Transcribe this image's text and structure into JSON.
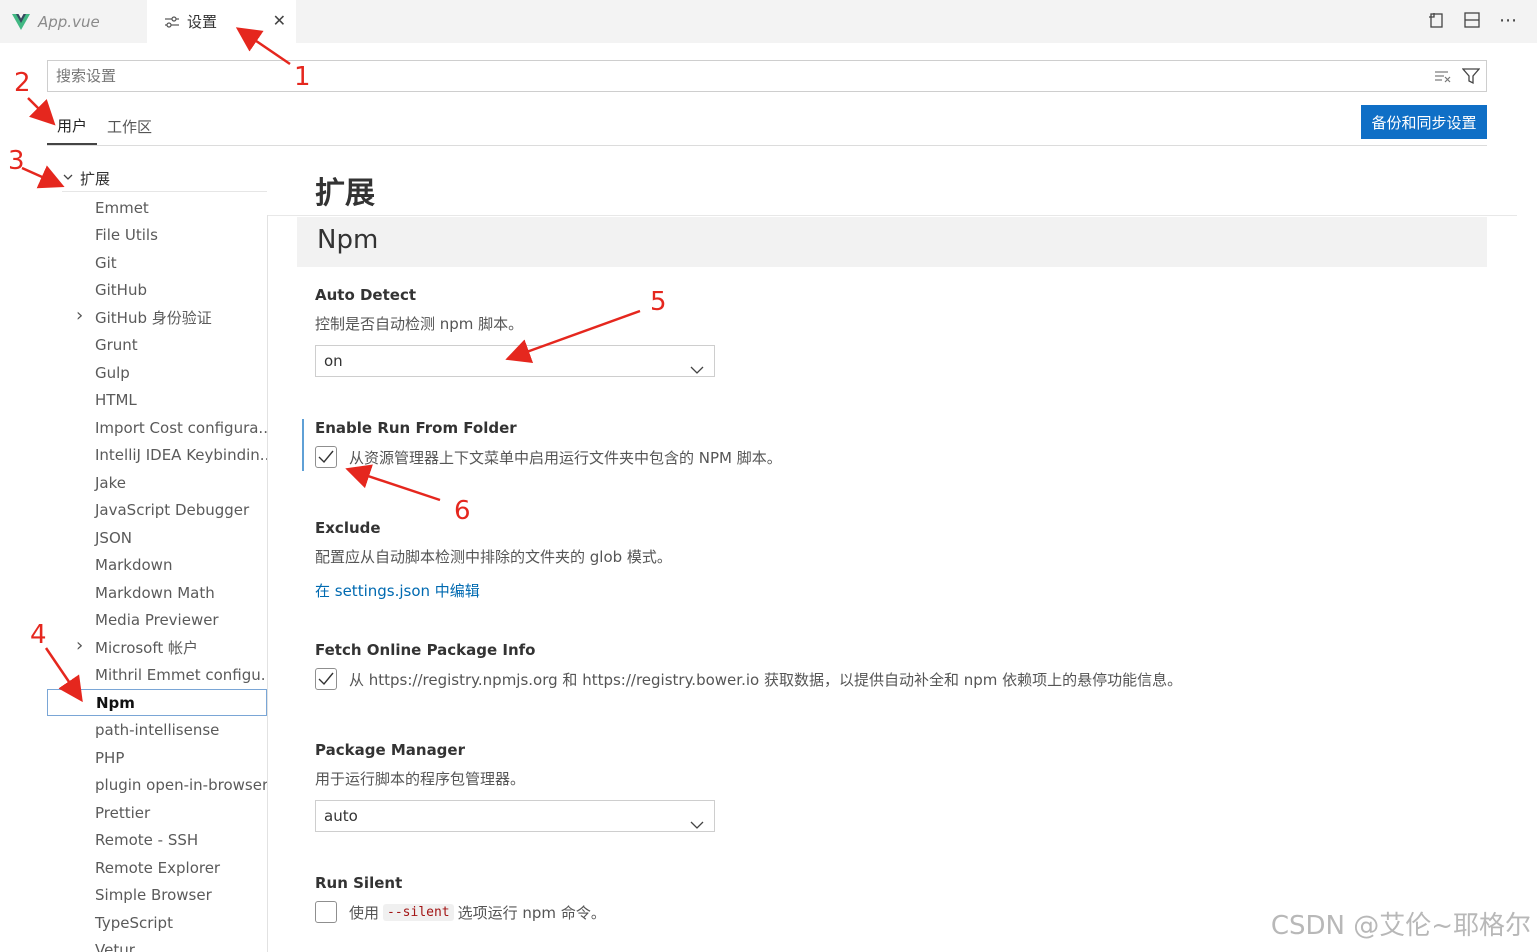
{
  "tabs": {
    "app_tab": "App.vue",
    "settings_tab": "设置"
  },
  "search": {
    "placeholder": "搜索设置"
  },
  "scope": {
    "user": "用户",
    "workspace": "工作区",
    "sync_button": "备份和同步设置"
  },
  "toc": {
    "group": "扩展",
    "items": [
      "Emmet",
      "File Utils",
      "Git",
      "GitHub",
      "GitHub 身份验证",
      "Grunt",
      "Gulp",
      "HTML",
      "Import Cost configura...",
      "IntelliJ IDEA Keybindin...",
      "Jake",
      "JavaScript Debugger",
      "JSON",
      "Markdown",
      "Markdown Math",
      "Media Previewer",
      "Microsoft 帐户",
      "Mithril Emmet configu...",
      "Npm",
      "path-intellisense",
      "PHP",
      "plugin open-in-browser",
      "Prettier",
      "Remote - SSH",
      "Remote Explorer",
      "Simple Browser",
      "TypeScript",
      "Vetur"
    ],
    "selected": "Npm"
  },
  "main": {
    "section_title": "扩展",
    "subsection_title": "Npm",
    "settings": {
      "auto_detect": {
        "title": "Auto Detect",
        "desc": "控制是否自动检测 npm 脚本。",
        "value": "on"
      },
      "run_from_folder": {
        "title": "Enable Run From Folder",
        "desc": "从资源管理器上下文菜单中启用运行文件夹中包含的 NPM 脚本。",
        "checked": true
      },
      "exclude": {
        "title": "Exclude",
        "desc": "配置应从自动脚本检测中排除的文件夹的 glob 模式。",
        "link": "在 settings.json 中编辑"
      },
      "fetch_online": {
        "title": "Fetch Online Package Info",
        "desc": "从 https://registry.npmjs.org 和 https://registry.bower.io 获取数据，以提供自动补全和 npm 依赖项上的悬停功能信息。",
        "checked": true
      },
      "package_manager": {
        "title": "Package Manager",
        "desc": "用于运行脚本的程序包管理器。",
        "value": "auto"
      },
      "run_silent": {
        "title": "Run Silent",
        "desc_before": "使用",
        "code": "--silent",
        "desc_after": "选项运行 npm 命令。",
        "checked": false
      }
    }
  },
  "annotations": [
    "1",
    "2",
    "3",
    "4",
    "5",
    "6"
  ],
  "watermark": "CSDN @艾伦~耶格尔",
  "colors": {
    "accent": "#0f6fc6",
    "annotation": "#e5271e",
    "link": "#006ab1"
  }
}
